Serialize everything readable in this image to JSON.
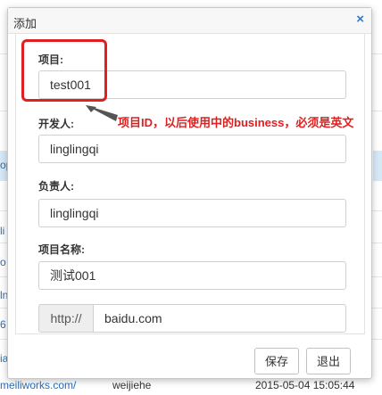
{
  "dialog": {
    "title": "添加",
    "close_glyph": "×"
  },
  "fields": {
    "project": {
      "label": "项目:",
      "value": "test001"
    },
    "developer": {
      "label": "开发人:",
      "value": "linglingqi"
    },
    "owner": {
      "label": "负责人:",
      "value": "linglingqi"
    },
    "project_name": {
      "label": "项目名称:",
      "value": "测试001"
    },
    "url": {
      "prefix": "http://",
      "value": "baidu.com"
    }
  },
  "buttons": {
    "save": "保存",
    "exit": "退出"
  },
  "annotation": {
    "text": "项目ID，以后使用中的business，必须是英文",
    "color": "#e02020"
  },
  "background": {
    "left_cells": [
      "op",
      "li",
      "o",
      "ln",
      "6",
      "ia"
    ],
    "footer": {
      "link": "meiliworks.com/",
      "user": "weijiehe",
      "time": "2015-05-04 15:05:44"
    }
  }
}
